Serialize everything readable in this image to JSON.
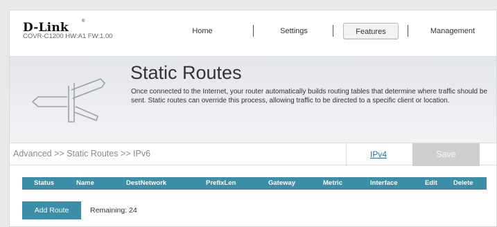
{
  "brand": {
    "logo": "D-Link",
    "trademark": "®",
    "model": "COVR-C1200 HW:A1 FW:1.00"
  },
  "nav": {
    "items": [
      {
        "label": "Home"
      },
      {
        "label": "Settings"
      },
      {
        "label": "Features",
        "active": true
      },
      {
        "label": "Management"
      }
    ]
  },
  "banner": {
    "title": "Static Routes",
    "description": "Once connected to the Internet, your router automatically builds routing tables that determine where traffic should be sent. Static routes can override this process, allowing traffic to be directed to a specific client or location.",
    "icon": "signpost-icon"
  },
  "toolbar": {
    "breadcrumb": "Advanced >> Static Routes >> IPv6",
    "ipv4_link": "IPv4",
    "save_label": "Save"
  },
  "table": {
    "columns": [
      "Status",
      "Name",
      "DestNetwork",
      "PrefixLen",
      "Gateway",
      "Metric",
      "Interface",
      "Edit",
      "Delete"
    ]
  },
  "footer": {
    "add_label": "Add Route",
    "remaining": "Remaining: 24"
  },
  "colors": {
    "accent": "#3a8ea8",
    "save_disabled": "#cfcfcf",
    "link": "#2b6fa8"
  }
}
